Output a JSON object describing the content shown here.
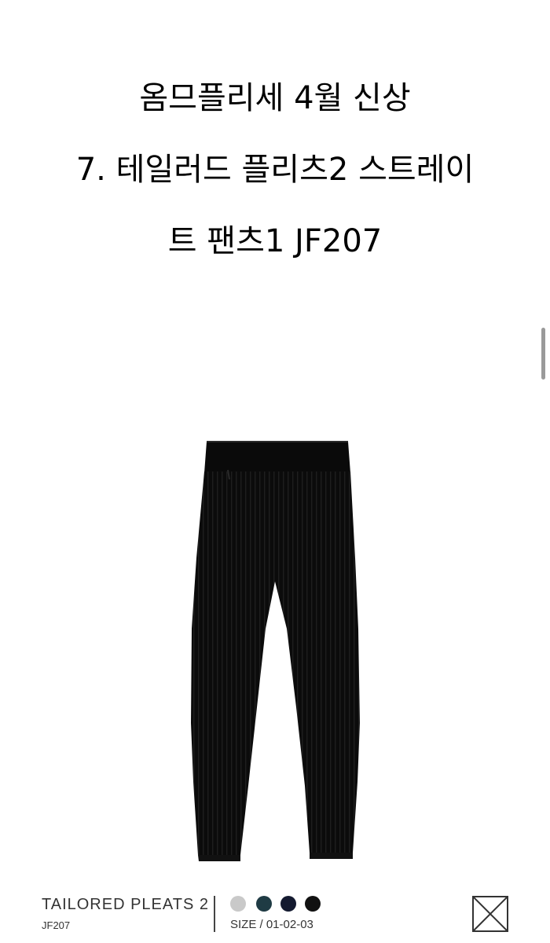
{
  "title": {
    "line1": "옴므플리세 4월 신상",
    "line2": "7. 테일러드 플리츠2 스트레이",
    "line3": "트 팬츠1 JF207"
  },
  "product": {
    "image_icon": "pleated-pants-image",
    "name": "TAILORED PLEATS 2",
    "code": "JF207",
    "size_label": "SIZE / 01-02-03",
    "swatches": [
      {
        "name": "light-gray",
        "color": "#c9c9c9"
      },
      {
        "name": "dark-teal",
        "color": "#1f3b44"
      },
      {
        "name": "navy",
        "color": "#141a30"
      },
      {
        "name": "black",
        "color": "#111111"
      }
    ],
    "close_icon": "crossed-box-icon"
  },
  "colors": {
    "background": "#ffffff",
    "text": "#000000",
    "pants": "#0b0b0b"
  }
}
